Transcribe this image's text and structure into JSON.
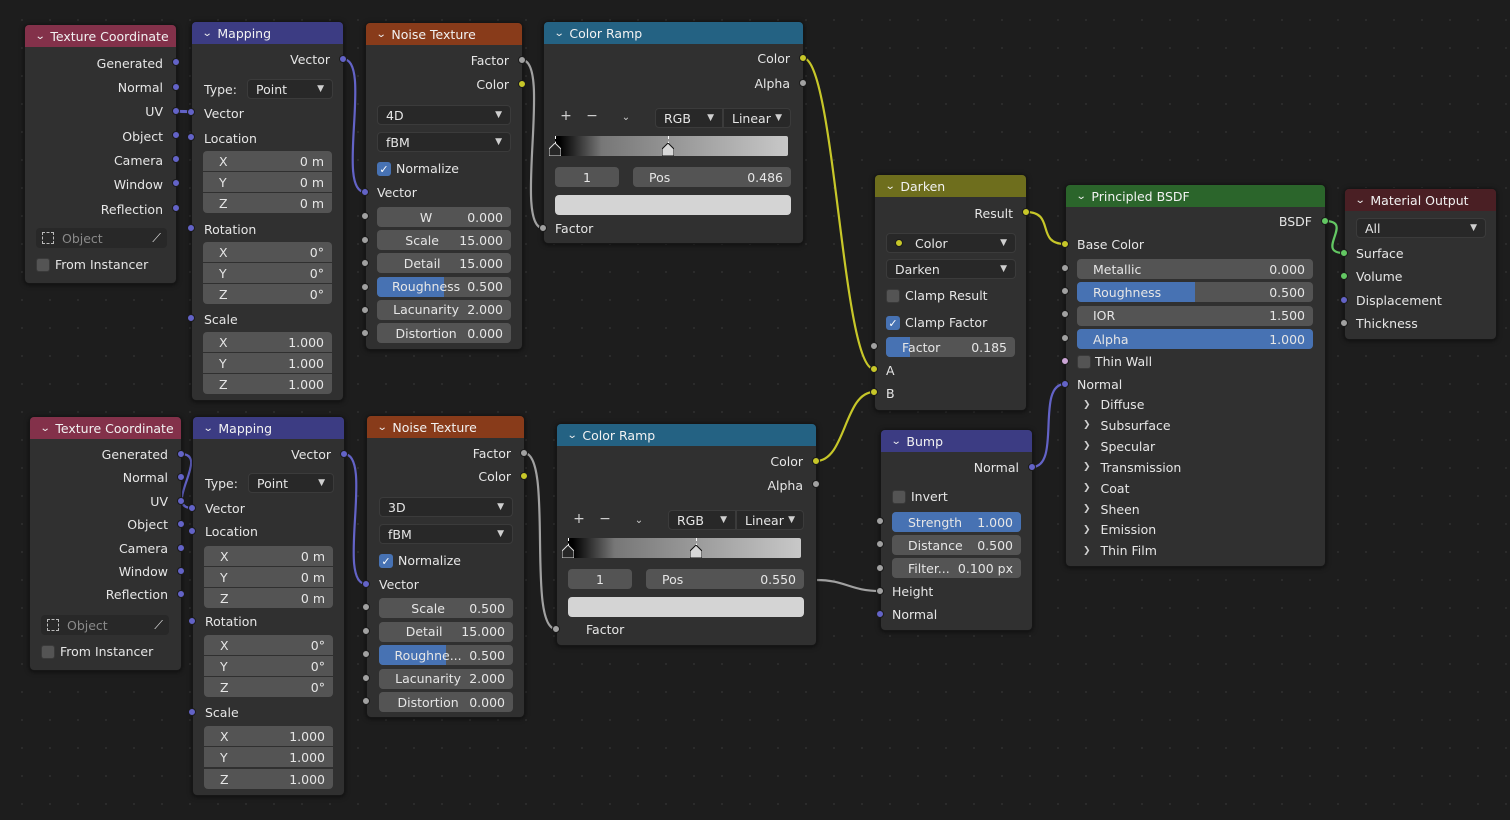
{
  "colors": {
    "input_header": "#83314a",
    "vector_header": "#3c3c83",
    "texture_header": "#883b1a",
    "converter_header": "#246283",
    "color_header": "#6e6e1d",
    "shader_header": "#2b652b",
    "output_header": "#4a1f24",
    "socket_vector": "#6363c7",
    "socket_color": "#c7c729",
    "socket_float": "#a1a1a1",
    "socket_shader": "#63c763",
    "slider_fill": "#4772b3"
  },
  "tex_coord_1": {
    "title": "Texture Coordinate",
    "outputs": [
      "Generated",
      "Normal",
      "UV",
      "Object",
      "Camera",
      "Window",
      "Reflection"
    ],
    "object_placeholder": "Object",
    "from_instancer": "From Instancer"
  },
  "tex_coord_2": {
    "title": "Texture Coordinate",
    "outputs": [
      "Generated",
      "Normal",
      "UV",
      "Object",
      "Camera",
      "Window",
      "Reflection"
    ],
    "object_placeholder": "Object",
    "from_instancer": "From Instancer"
  },
  "mapping_1": {
    "title": "Mapping",
    "out_vector": "Vector",
    "type_label": "Type:",
    "type_value": "Point",
    "in_vector": "Vector",
    "location": "Location",
    "loc": [
      {
        "axis": "X",
        "value": "0 m"
      },
      {
        "axis": "Y",
        "value": "0 m"
      },
      {
        "axis": "Z",
        "value": "0 m"
      }
    ],
    "rotation": "Rotation",
    "rot": [
      {
        "axis": "X",
        "value": "0°"
      },
      {
        "axis": "Y",
        "value": "0°"
      },
      {
        "axis": "Z",
        "value": "0°"
      }
    ],
    "scale": "Scale",
    "scl": [
      {
        "axis": "X",
        "value": "1.000"
      },
      {
        "axis": "Y",
        "value": "1.000"
      },
      {
        "axis": "Z",
        "value": "1.000"
      }
    ]
  },
  "mapping_2": {
    "title": "Mapping",
    "out_vector": "Vector",
    "type_label": "Type:",
    "type_value": "Point",
    "in_vector": "Vector",
    "location": "Location",
    "loc": [
      {
        "axis": "X",
        "value": "0 m"
      },
      {
        "axis": "Y",
        "value": "0 m"
      },
      {
        "axis": "Z",
        "value": "0 m"
      }
    ],
    "rotation": "Rotation",
    "rot": [
      {
        "axis": "X",
        "value": "0°"
      },
      {
        "axis": "Y",
        "value": "0°"
      },
      {
        "axis": "Z",
        "value": "0°"
      }
    ],
    "scale": "Scale",
    "scl": [
      {
        "axis": "X",
        "value": "1.000"
      },
      {
        "axis": "Y",
        "value": "1.000"
      },
      {
        "axis": "Z",
        "value": "1.000"
      }
    ]
  },
  "noise_1": {
    "title": "Noise Texture",
    "out_factor": "Factor",
    "out_color": "Color",
    "dimensions": "4D",
    "noise_type": "fBM",
    "normalize": "Normalize",
    "in_vector": "Vector",
    "fields": [
      {
        "label": "W",
        "value": "0.000",
        "fill": 0
      },
      {
        "label": "Scale",
        "value": "15.000",
        "fill": 0
      },
      {
        "label": "Detail",
        "value": "15.000",
        "fill": 0
      },
      {
        "label": "Roughness",
        "value": "0.500",
        "fill": 0.5
      },
      {
        "label": "Lacunarity",
        "value": "2.000",
        "fill": 0
      },
      {
        "label": "Distortion",
        "value": "0.000",
        "fill": 0
      }
    ]
  },
  "noise_2": {
    "title": "Noise Texture",
    "out_factor": "Factor",
    "out_color": "Color",
    "dimensions": "3D",
    "noise_type": "fBM",
    "normalize": "Normalize",
    "in_vector": "Vector",
    "fields": [
      {
        "label": "Scale",
        "value": "0.500",
        "fill": 0
      },
      {
        "label": "Detail",
        "value": "15.000",
        "fill": 0
      },
      {
        "label": "Roughne...",
        "value": "0.500",
        "fill": 0.5
      },
      {
        "label": "Lacunarity",
        "value": "2.000",
        "fill": 0
      },
      {
        "label": "Distortion",
        "value": "0.000",
        "fill": 0
      }
    ]
  },
  "ramp_1": {
    "title": "Color Ramp",
    "out_color": "Color",
    "out_alpha": "Alpha",
    "color_mode": "RGB",
    "interpolation": "Linear",
    "stop_index": "1",
    "pos_label": "Pos",
    "pos_value": "0.486",
    "stop_positions": [
      0,
      0.486
    ],
    "in_factor": "Factor"
  },
  "ramp_2": {
    "title": "Color Ramp",
    "out_color": "Color",
    "out_alpha": "Alpha",
    "color_mode": "RGB",
    "interpolation": "Linear",
    "stop_index": "1",
    "pos_label": "Pos",
    "pos_value": "0.550",
    "stop_positions": [
      0,
      0.55
    ],
    "in_factor": "Factor"
  },
  "darken": {
    "title": "Darken",
    "out_result": "Result",
    "data_type": "Color",
    "blend": "Darken",
    "clamp_result": "Clamp Result",
    "clamp_factor": "Clamp Factor",
    "factor_label": "Factor",
    "factor_value": "0.185",
    "factor_fill": 0.185,
    "in_a": "A",
    "in_b": "B"
  },
  "bump": {
    "title": "Bump",
    "out_normal": "Normal",
    "invert": "Invert",
    "strength_label": "Strength",
    "strength_value": "1.000",
    "strength_fill": 1,
    "distance_label": "Distance",
    "distance_value": "0.500",
    "filter_label": "Filter...",
    "filter_value": "0.100 px",
    "in_height": "Height",
    "in_normal": "Normal"
  },
  "bsdf": {
    "title": "Principled BSDF",
    "out_bsdf": "BSDF",
    "base_color": "Base Color",
    "fields": [
      {
        "label": "Metallic",
        "value": "0.000",
        "fill": 0
      },
      {
        "label": "Roughness",
        "value": "0.500",
        "fill": 0.5
      },
      {
        "label": "IOR",
        "value": "1.500",
        "fill": 0
      },
      {
        "label": "Alpha",
        "value": "1.000",
        "fill": 1
      }
    ],
    "thin_wall": "Thin Wall",
    "normal": "Normal",
    "panels": [
      "Diffuse",
      "Subsurface",
      "Specular",
      "Transmission",
      "Coat",
      "Sheen",
      "Emission",
      "Thin Film"
    ]
  },
  "output": {
    "title": "Material Output",
    "target": "All",
    "inputs": [
      "Surface",
      "Volume",
      "Displacement",
      "Thickness"
    ]
  }
}
